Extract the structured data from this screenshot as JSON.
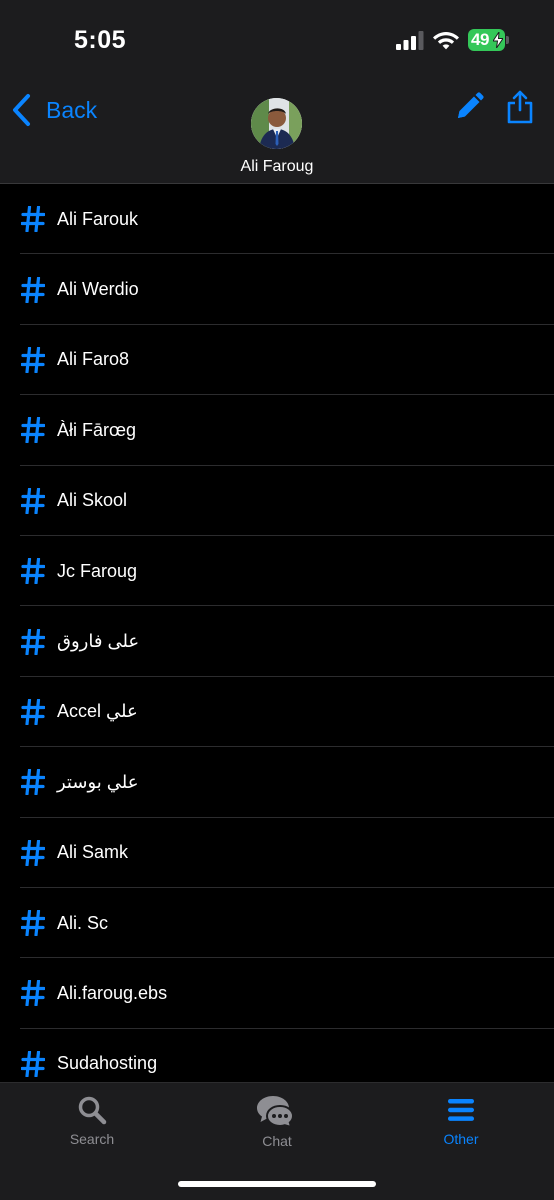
{
  "status_bar": {
    "time": "5:05",
    "battery_level": "49",
    "battery_charging": true,
    "icons": [
      "signal-icon",
      "wifi-icon",
      "battery-icon"
    ]
  },
  "header": {
    "back_label": "Back",
    "contact_name": "Ali Faroug",
    "actions": [
      "edit-icon",
      "share-icon"
    ]
  },
  "list": {
    "icon": "hash-icon",
    "items": [
      {
        "label": "Ali Farouk"
      },
      {
        "label": "Ali Werdio"
      },
      {
        "label": "Ali Faro8"
      },
      {
        "label": "Àłi Fārœg"
      },
      {
        "label": "Ali Skool"
      },
      {
        "label": "Jc Faroug"
      },
      {
        "label": "على فاروق"
      },
      {
        "label": "Accel علي"
      },
      {
        "label": "علي بوستر"
      },
      {
        "label": "Ali Samk"
      },
      {
        "label": "Ali. Sc"
      },
      {
        "label": "Ali.faroug.ebs"
      },
      {
        "label": "Sudahosting"
      }
    ]
  },
  "tab_bar": {
    "tabs": [
      {
        "label": "Search",
        "icon": "search-icon",
        "active": false
      },
      {
        "label": "Chat",
        "icon": "chat-icon",
        "active": false
      },
      {
        "label": "Other",
        "icon": "menu-icon",
        "active": true
      }
    ]
  },
  "colors": {
    "accent": "#0a84ff",
    "background": "#000000",
    "bar_background": "#1c1c1e",
    "inactive_tab": "#8e8e93",
    "battery": "#34c759"
  }
}
